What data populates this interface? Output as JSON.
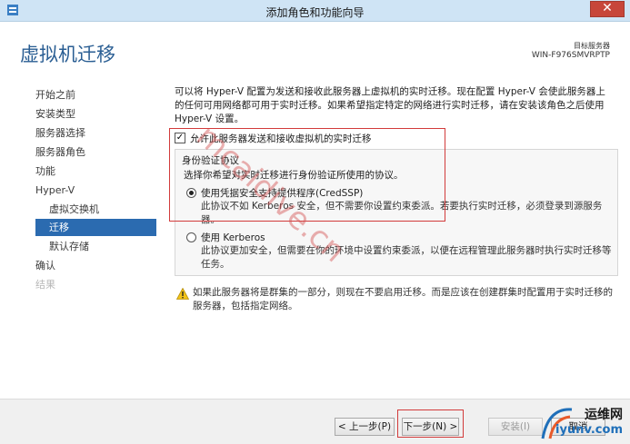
{
  "window": {
    "title": "添加角色和功能向导",
    "close_glyph": "✕"
  },
  "header": {
    "page_title": "虚拟机迁移",
    "target_label": "目标服务器",
    "target_value": "WIN-F976SMVRPTP"
  },
  "nav": {
    "items": [
      {
        "label": "开始之前"
      },
      {
        "label": "安装类型"
      },
      {
        "label": "服务器选择"
      },
      {
        "label": "服务器角色"
      },
      {
        "label": "功能"
      },
      {
        "label": "Hyper-V"
      },
      {
        "label": "虚拟交换机"
      },
      {
        "label": "迁移"
      },
      {
        "label": "默认存储"
      },
      {
        "label": "确认"
      },
      {
        "label": "结果"
      }
    ]
  },
  "content": {
    "intro": "可以将 Hyper-V 配置为发送和接收此服务器上虚拟机的实时迁移。现在配置 Hyper-V 会使此服务器上的任何可用网络都可用于实时迁移。如果希望指定特定的网络进行实时迁移，请在安装该角色之后使用 Hyper-V 设置。",
    "allow_checkbox": {
      "label": "允许此服务器发送和接收虚拟机的实时迁移",
      "checked": true,
      "glyph": "✓"
    },
    "auth": {
      "title": "身份验证协议",
      "desc": "选择你希望对实时迁移进行身份验证所使用的协议。",
      "options": [
        {
          "label": "使用凭据安全支持提供程序(CredSSP)",
          "desc": "此协议不如 Kerberos 安全，但不需要你设置约束委派。若要执行实时迁移，必须登录到源服务器。",
          "selected": true
        },
        {
          "label": "使用 Kerberos",
          "desc": "此协议更加安全，但需要在你的环境中设置约束委派，以便在远程管理此服务器时执行实时迁移等任务。",
          "selected": false
        }
      ]
    },
    "warning": "如果此服务器将是群集的一部分，则现在不要启用迁移。而是应该在创建群集时配置用于实时迁移的服务器，包括指定网络。"
  },
  "footer": {
    "prev": "< 上一步(P)",
    "next": "下一步(N) >",
    "install": "安装(I)",
    "cancel": "取消"
  },
  "overlay": {
    "watermark": "mcaidive.cn",
    "logo_top": "运维网",
    "logo_bottom": "iyunv.com"
  },
  "colors": {
    "accent": "#2b6bb0",
    "title": "#2a5e93",
    "highlight": "#d23b3b"
  }
}
